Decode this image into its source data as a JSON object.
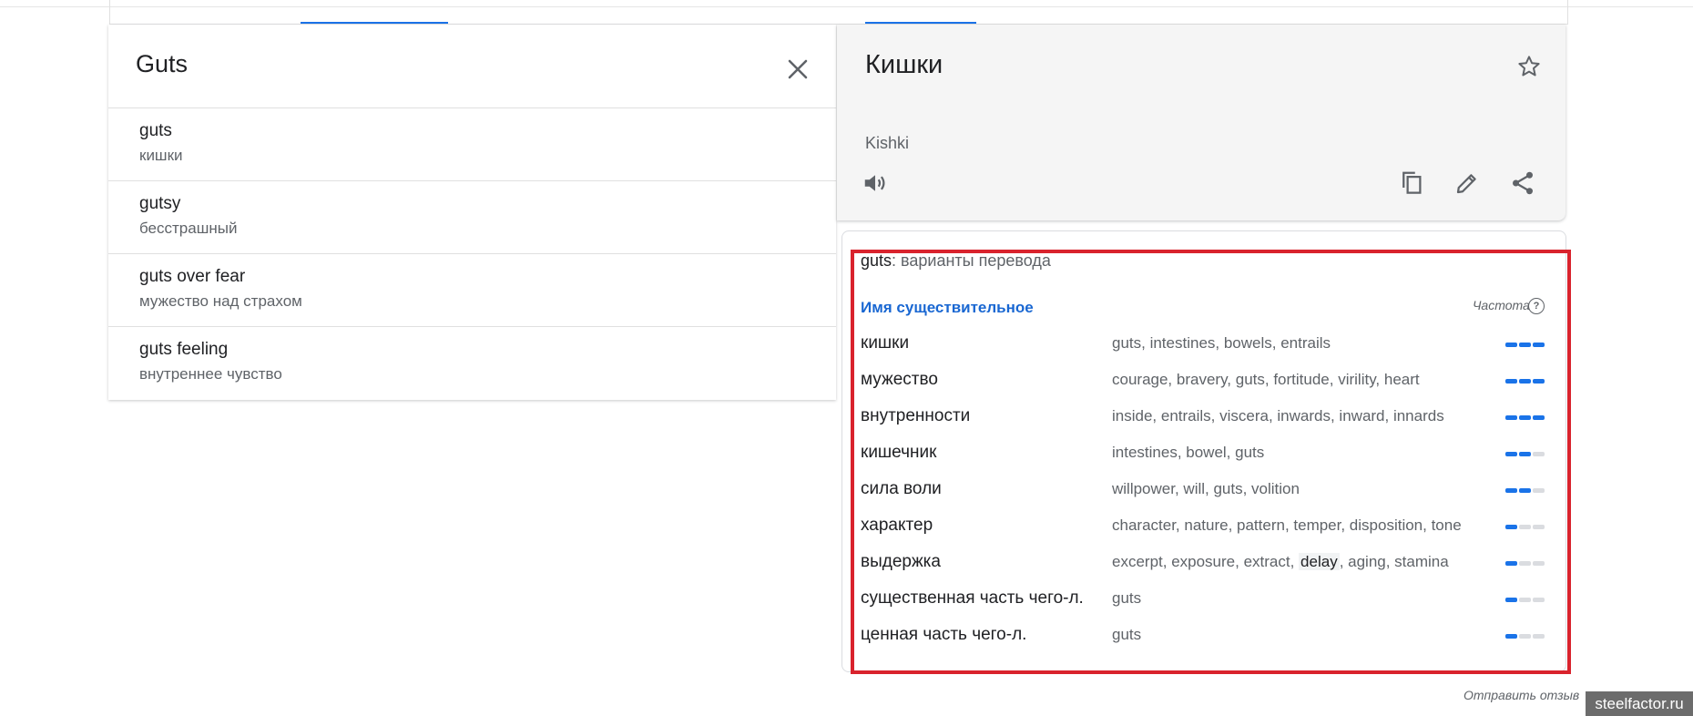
{
  "source_input": {
    "value": "Guts"
  },
  "suggestions": [
    {
      "source": "guts",
      "translation": "кишки"
    },
    {
      "source": "gutsy",
      "translation": "бесстрашный"
    },
    {
      "source": "guts over fear",
      "translation": "мужество над страхом"
    },
    {
      "source": "guts feeling",
      "translation": "внутреннее чувство"
    }
  ],
  "translation": {
    "text": "Кишки",
    "transliteration": "Kishki"
  },
  "dictionary": {
    "word": "guts",
    "header_rest": ": варианты перевода",
    "part_of_speech": "Имя существительное",
    "frequency_label": "Частота",
    "frequency_help": "?",
    "entries": [
      {
        "word": "кишки",
        "synonyms": "guts, intestines, bowels, entrails",
        "frequency": 3
      },
      {
        "word": "мужество",
        "synonyms": "courage, bravery, guts, fortitude, virility, heart",
        "frequency": 3
      },
      {
        "word": "внутренности",
        "synonyms": "inside, entrails, viscera, inwards, inward, innards",
        "frequency": 3
      },
      {
        "word": "кишечник",
        "synonyms": "intestines, bowel, guts",
        "frequency": 2
      },
      {
        "word": "сила воли",
        "synonyms": "willpower, will, guts, volition",
        "frequency": 2
      },
      {
        "word": "характер",
        "synonyms": "character, nature, pattern, temper, disposition, tone",
        "frequency": 1
      },
      {
        "word": "выдержка",
        "synonyms_before": "excerpt, exposure, extract, ",
        "synonyms_highlight": "delay",
        "synonyms_after": ", aging, stamina",
        "frequency": 1
      },
      {
        "word": "существенная часть чего-л.",
        "synonyms": "guts",
        "frequency": 1
      },
      {
        "word": "ценная часть чего-л.",
        "synonyms": "guts",
        "frequency": 1
      }
    ]
  },
  "feedback_link": "Отправить отзыв",
  "watermark": "steelfactor.ru",
  "colors": {
    "accent": "#1a73e8",
    "highlight_frame": "#d9232d",
    "frequency_off": "#dadce0"
  },
  "icons": [
    "close-icon",
    "star-icon",
    "speaker-icon",
    "copy-icon",
    "pencil-icon",
    "share-icon",
    "help-icon"
  ]
}
